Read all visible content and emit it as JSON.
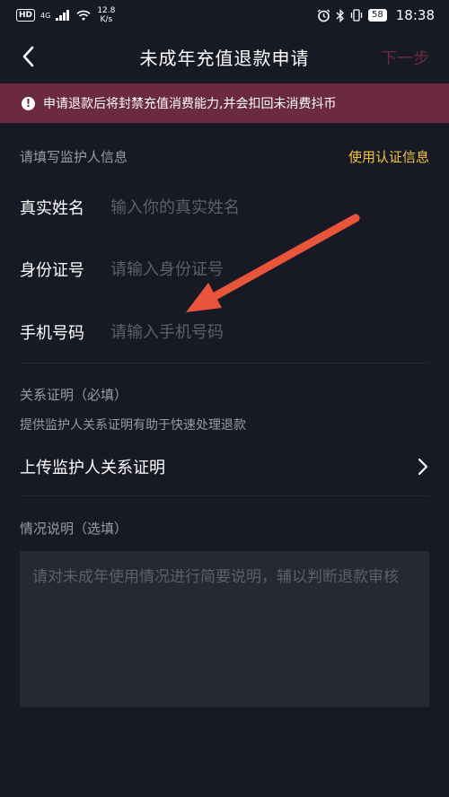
{
  "status_bar": {
    "hd": "HD",
    "network": "4G",
    "speed_value": "12.8",
    "speed_unit": "K/s",
    "battery": "58",
    "time": "18:38"
  },
  "nav": {
    "title": "未成年充值退款申请",
    "next_label": "下一步"
  },
  "warning": {
    "text": "申请退款后将封禁充值消费能力,并会扣回未消费抖币"
  },
  "guardian": {
    "section_title": "请填写监护人信息",
    "use_verified_link": "使用认证信息",
    "fields": [
      {
        "label": "真实姓名",
        "placeholder": "输入你的真实姓名"
      },
      {
        "label": "身份证号",
        "placeholder": "请输入身份证号"
      },
      {
        "label": "手机号码",
        "placeholder": "请输入手机号码"
      }
    ]
  },
  "relation": {
    "title": "关系证明（必填）",
    "hint": "提供监护人关系证明有助于快速处理退款",
    "upload_label": "上传监护人关系证明"
  },
  "situation": {
    "title": "情况说明（选填）",
    "placeholder": "请对未成年使用情况进行简要说明，辅以判断退款审核"
  },
  "colors": {
    "background": "#171924",
    "banner": "#6b2a3d",
    "link": "#f2c53d",
    "annotation_arrow": "#e8553a"
  }
}
